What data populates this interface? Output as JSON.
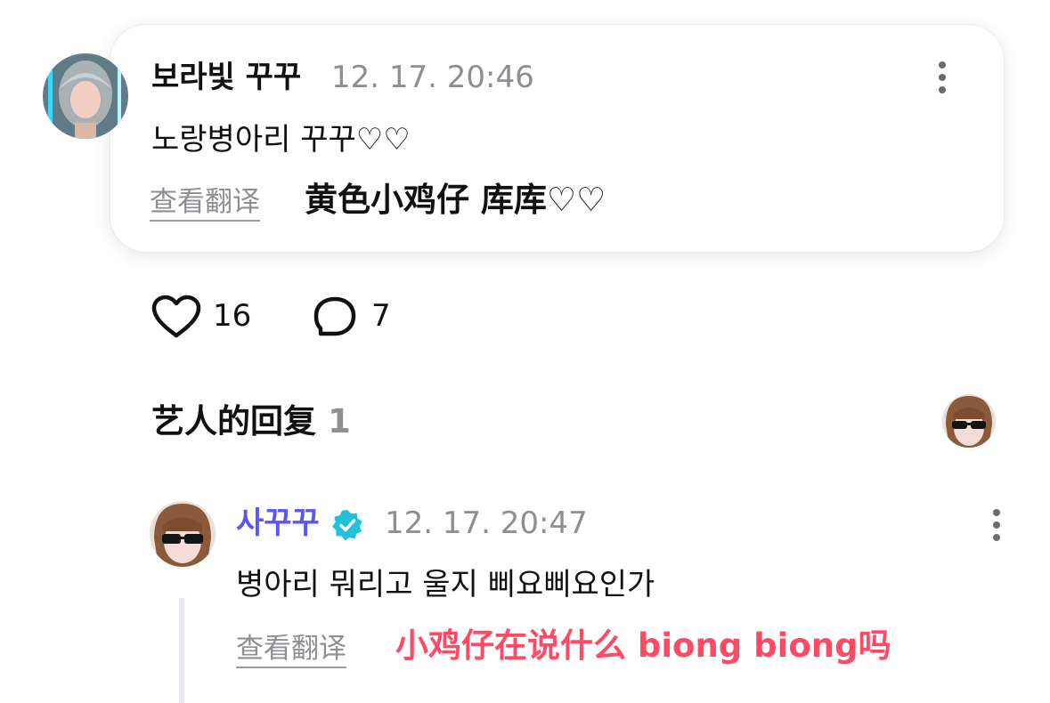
{
  "colors": {
    "artist_name": "#5b55f2",
    "verified_badge": "#1fc2d6",
    "reply_translation": "#ff4a66"
  },
  "comment": {
    "author": "보라빛 꾸꾸",
    "timestamp": "12. 17. 20:46",
    "text": "노랑병아리 꾸꾸♡♡",
    "translate_label": "查看翻译",
    "translated_text": "黄色小鸡仔 库库♡♡",
    "likes": "16",
    "replies": "7"
  },
  "artist_replies": {
    "title": "艺人的回复",
    "count": "1"
  },
  "reply": {
    "author": "사꾸꾸",
    "timestamp": "12. 17. 20:47",
    "text": "병아리 뭐리고 울지 삐요삐요인가",
    "translate_label": "查看翻译",
    "translated_text": "小鸡仔在说什么 biong biong吗"
  }
}
